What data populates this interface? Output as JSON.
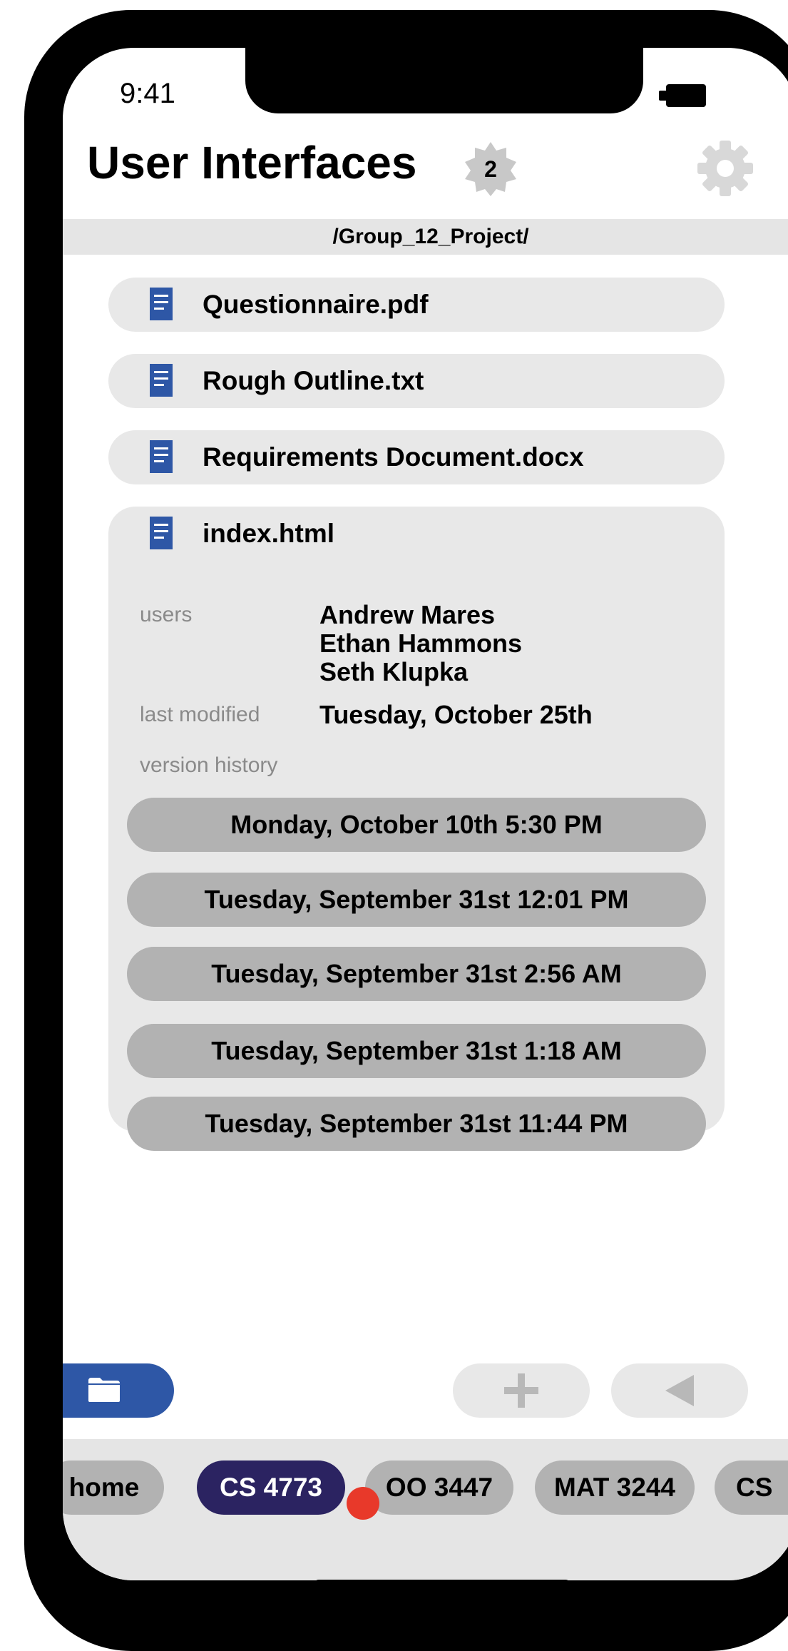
{
  "status_bar": {
    "time": "9:41"
  },
  "header": {
    "title": "User Interfaces",
    "badge_count": "2"
  },
  "path": "/Group_12_Project/",
  "files": [
    {
      "name": "Questionnaire.pdf"
    },
    {
      "name": "Rough Outline.txt"
    },
    {
      "name": "Requirements Document.docx"
    }
  ],
  "expanded_file": {
    "name": "index.html",
    "users_label": "users",
    "users": [
      "Andrew Mares",
      "Ethan Hammons",
      "Seth Klupka"
    ],
    "last_modified_label": "last modified",
    "last_modified": "Tuesday, October 25th",
    "version_history_label": "version history",
    "versions": [
      "Monday, October 10th 5:30 PM",
      "Tuesday, September 31st 12:01 PM",
      "Tuesday, September 31st 2:56 AM",
      "Tuesday, September 31st 1:18 AM",
      "Tuesday, September 31st 11:44 PM"
    ]
  },
  "actions": {
    "folder_icon": "folder-icon",
    "add_icon": "plus-icon",
    "back_icon": "back-triangle-icon"
  },
  "tabs": [
    {
      "label": "home"
    },
    {
      "label": "CS 4773",
      "active": true,
      "has_notification": true
    },
    {
      "label": "OO 3447"
    },
    {
      "label": "MAT 3244"
    },
    {
      "label": "CS"
    }
  ],
  "colors": {
    "accent_blue": "#2e57a6",
    "active_tab": "#2b2361",
    "notification": "#e8392a",
    "file_icon": "#2e57a6"
  }
}
